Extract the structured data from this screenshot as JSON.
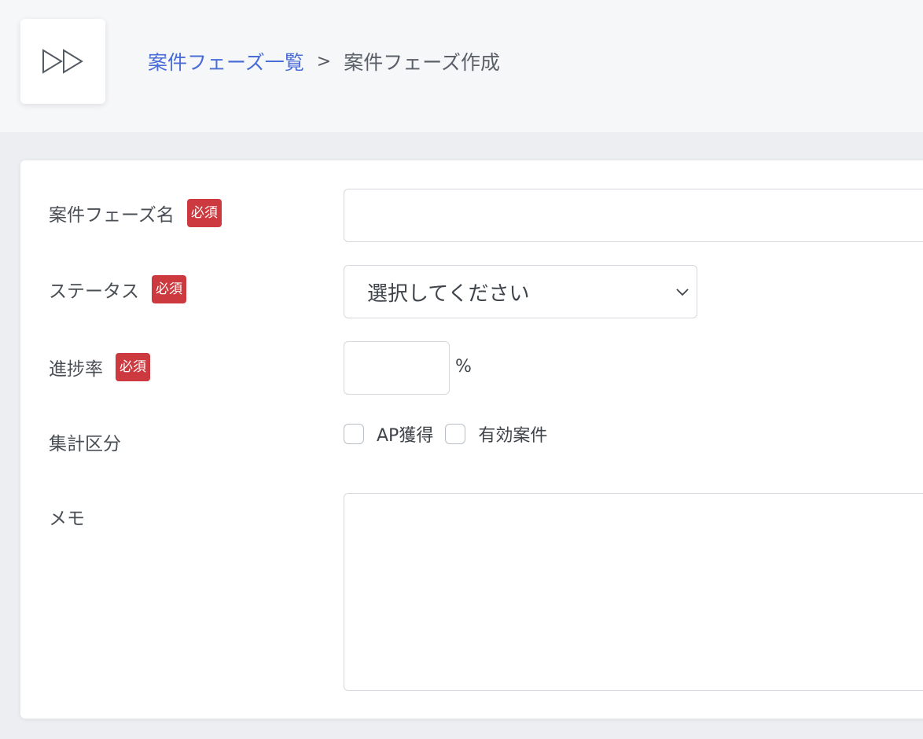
{
  "header": {
    "logo_icon": "fast-forward-icon",
    "breadcrumb": {
      "link_label": "案件フェーズ一覧",
      "separator": ">",
      "current_label": "案件フェーズ作成"
    }
  },
  "form": {
    "phase_name": {
      "label": "案件フェーズ名",
      "required_badge": "必須",
      "value": "",
      "placeholder": ""
    },
    "status": {
      "label": "ステータス",
      "required_badge": "必須",
      "selected": "選択してください"
    },
    "progress": {
      "label": "進捗率",
      "required_badge": "必須",
      "value": "",
      "unit": "%"
    },
    "aggregation": {
      "label": "集計区分",
      "options": [
        {
          "label": "AP獲得",
          "checked": false
        },
        {
          "label": "有効案件",
          "checked": false
        }
      ]
    },
    "memo": {
      "label": "メモ",
      "value": ""
    }
  },
  "colors": {
    "link": "#4a6cd6",
    "required_badge": "#cc3a3f",
    "border": "#d4d8dd",
    "background": "#eceef2"
  }
}
